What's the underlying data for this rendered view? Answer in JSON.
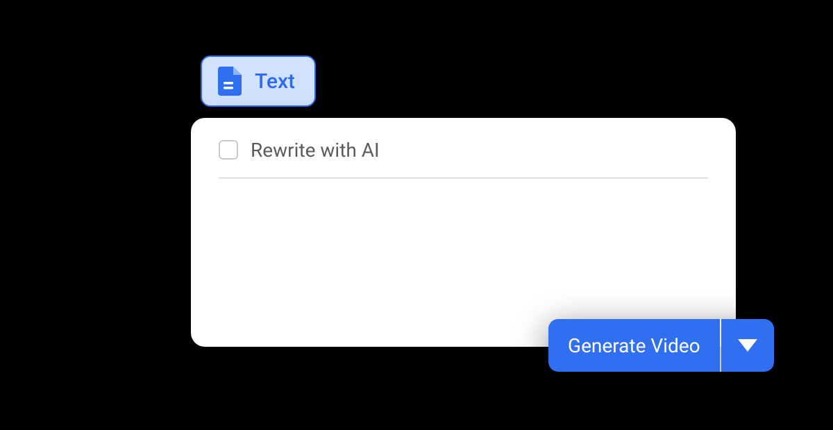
{
  "tab": {
    "label": "Text",
    "icon": "document-icon"
  },
  "panel": {
    "rewrite_label": "Rewrite with AI",
    "rewrite_checked": false,
    "text_value": ""
  },
  "actions": {
    "generate_label": "Generate Video"
  },
  "colors": {
    "accent": "#2F6FF0",
    "tab_bg": "#D0E2FE",
    "tab_border": "#2C6BEF"
  }
}
